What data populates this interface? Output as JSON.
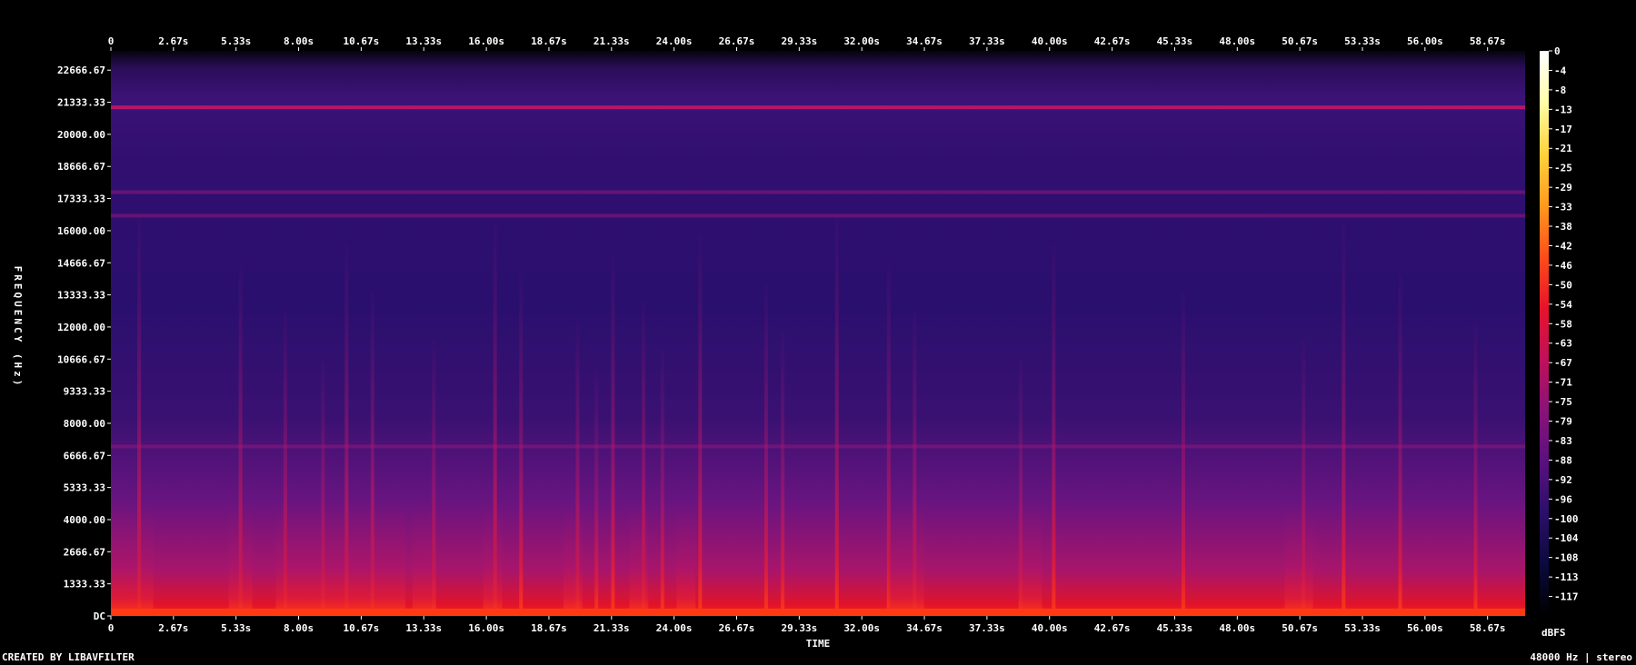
{
  "chart_data": {
    "type": "heatmap",
    "subtype": "spectrogram",
    "xlabel": "TIME",
    "ylabel": "FREQUENCY (Hz)",
    "x_range_seconds": [
      0,
      60
    ],
    "y_range_hz": [
      0,
      24000
    ],
    "x_ticks": [
      "0",
      "2.67s",
      "5.33s",
      "8.00s",
      "10.67s",
      "13.33s",
      "16.00s",
      "18.67s",
      "21.33s",
      "24.00s",
      "26.67s",
      "29.33s",
      "32.00s",
      "34.67s",
      "37.33s",
      "40.00s",
      "42.67s",
      "45.33s",
      "48.00s",
      "50.67s",
      "53.33s",
      "56.00s",
      "58.67s"
    ],
    "y_ticks": [
      "DC",
      "1333.33",
      "2666.67",
      "4000.00",
      "5333.33",
      "6666.67",
      "8000.00",
      "9333.33",
      "10666.67",
      "12000.00",
      "13333.33",
      "14666.67",
      "16000.00",
      "17333.33",
      "18666.67",
      "20000.00",
      "21333.33",
      "22666.67"
    ],
    "colorbar": {
      "unit": "dBFS",
      "ticks": [
        "0",
        "-4",
        "-8",
        "-13",
        "-17",
        "-21",
        "-25",
        "-29",
        "-33",
        "-38",
        "-42",
        "-46",
        "-50",
        "-54",
        "-58",
        "-63",
        "-67",
        "-71",
        "-75",
        "-79",
        "-83",
        "-88",
        "-92",
        "-96",
        "-100",
        "-104",
        "-108",
        "-113",
        "-117"
      ],
      "range_db": [
        -120,
        0
      ],
      "colors": [
        "#000000",
        "#0b0a3c",
        "#2a0f6b",
        "#5a1080",
        "#8a1378",
        "#c0105a",
        "#e8132a",
        "#ff4d1a",
        "#ff9a1f",
        "#ffd23a",
        "#ffffa8",
        "#ffffff"
      ]
    },
    "horizontal_bands_hz": [
      21600,
      18000,
      17000,
      7200
    ],
    "vertical_bursts_seconds": [
      1.2,
      5.5,
      7.4,
      9.0,
      10.0,
      11.1,
      13.7,
      16.3,
      17.4,
      19.8,
      20.6,
      21.3,
      22.6,
      23.4,
      25.0,
      27.8,
      28.5,
      30.8,
      33.0,
      34.1,
      38.6,
      40.0,
      45.5,
      50.6,
      52.3,
      54.7,
      57.9
    ],
    "loud_low_regions_seconds": [
      [
        0,
        1.8
      ],
      [
        5.0,
        6.0
      ],
      [
        7.0,
        12.5
      ],
      [
        12.8,
        13.8
      ],
      [
        15.8,
        16.6
      ],
      [
        19.2,
        20.0
      ],
      [
        22.0,
        22.8
      ],
      [
        24.0,
        24.8
      ],
      [
        33.0,
        34.5
      ],
      [
        38.5,
        39.5
      ],
      [
        49.8,
        51.0
      ]
    ]
  },
  "footer": {
    "credit": "CREATED BY LIBAVFILTER",
    "format": "48000 Hz | stereo"
  }
}
